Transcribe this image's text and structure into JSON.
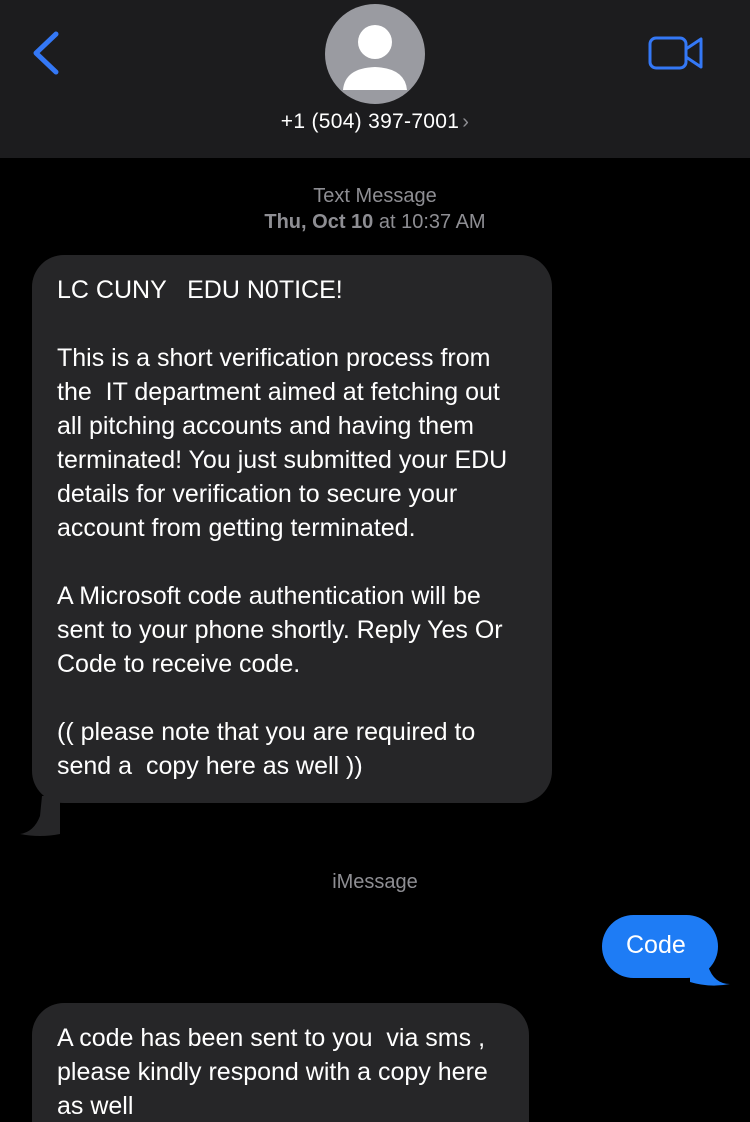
{
  "colors": {
    "background": "#000000",
    "header": "#1c1c1e",
    "accent": "#3478f6",
    "incoming_bubble": "#262628",
    "outgoing_bubble": "#1e7cf5",
    "secondary_text": "#8e8e93"
  },
  "header": {
    "back_icon": "chevron-left-icon",
    "avatar_icon": "person-silhouette-icon",
    "contact_number": "+1 (504) 397-7001",
    "contact_chevron": "›",
    "video_icon": "video-camera-icon"
  },
  "thread": {
    "service_label": "Text Message",
    "date_day": "Thu, Oct 10",
    "date_at": "at",
    "date_time": "10:37 AM",
    "imessage_label": "iMessage",
    "messages": [
      {
        "direction": "incoming",
        "text": "LC CUNY   EDU N0TICE!\n\nThis is a short verification process from the  IT department aimed at fetching out all pitching accounts and having them terminated! You just submitted your EDU details for verification to secure your account from getting terminated.\n\nA Microsoft code authentication will be sent to your phone shortly. Reply Yes Or Code to receive code.\n\n(( please note that you are required to send a  copy here as well ))"
      },
      {
        "direction": "outgoing",
        "text": "Code"
      },
      {
        "direction": "incoming",
        "text": "A code has been sent to you  via sms , please kindly respond with a copy here as well"
      }
    ]
  }
}
